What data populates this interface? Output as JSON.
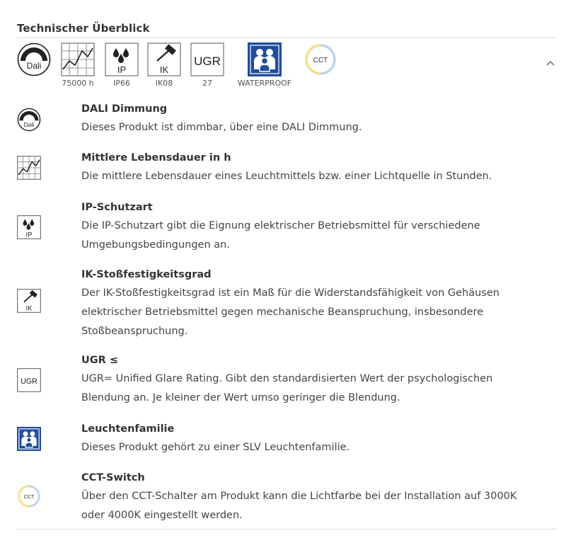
{
  "section": {
    "title": "Technischer Überblick"
  },
  "strip": [
    {
      "icon": "dali-icon",
      "label": ""
    },
    {
      "icon": "lifetime-chart-icon",
      "label": "75000 h"
    },
    {
      "icon": "ip-rating-icon",
      "label": "IP66"
    },
    {
      "icon": "ik-rating-icon",
      "label": "IK08"
    },
    {
      "icon": "ugr-icon",
      "label": "27"
    },
    {
      "icon": "family-icon",
      "label": "WATERPROOF"
    },
    {
      "icon": "cct-icon",
      "label": ""
    }
  ],
  "icon_text": {
    "dali": "Dali",
    "ip": "IP",
    "ik": "IK",
    "ugr": "UGR",
    "cct": "CCT"
  },
  "toggle_glyph": "^",
  "features": [
    {
      "icon": "dali-icon",
      "name": "DALI Dimmung",
      "lines": [
        "Dieses Produkt ist dimmbar, über eine DALI Dimmung."
      ]
    },
    {
      "icon": "lifetime-chart-icon",
      "name": "Mittlere Lebensdauer in h",
      "lines": [
        "Die mittlere Lebensdauer eines Leuchtmittels bzw. einer Lichtquelle in Stunden."
      ]
    },
    {
      "icon": "ip-rating-icon",
      "name": "IP-Schutzart",
      "lines": [
        "Die IP-Schutzart gibt die Eignung elektrischer Betriebsmittel für verschiedene",
        "Umgebungsbedingungen an."
      ]
    },
    {
      "icon": "ik-rating-icon",
      "name": "IK-Stoßfestigkeitsgrad",
      "lines": [
        "Der IK-Stoßfestigkeitsgrad ist ein Maß für die Widerstandsfähigkeit von Gehäusen",
        "elektrischer Betriebsmittel gegen mechanische Beanspruchung, insbesondere",
        "Stoßbeanspruchung."
      ]
    },
    {
      "icon": "ugr-icon",
      "name": "UGR ≤",
      "lines": [
        "UGR= Unified Glare Rating. Gibt den standardisierten Wert der psychologischen",
        "Blendung an. Je kleiner der Wert umso geringer die Blendung."
      ]
    },
    {
      "icon": "family-icon",
      "name": "Leuchtenfamilie",
      "lines": [
        "Dieses Produkt gehört zu einer SLV Leuchtenfamilie."
      ]
    },
    {
      "icon": "cct-icon",
      "name": "CCT-Switch",
      "lines": [
        "Über den CCT-Schalter am Produkt kann die Lichtfarbe bei der Installation auf 3000K",
        "oder 4000K eingestellt werden."
      ]
    }
  ],
  "colors": {
    "family_blue": "#1f4e9c",
    "cct_yellow": "#f3e08a",
    "cct_blue": "#bcd6ee",
    "rule": "#dcdcdc"
  }
}
